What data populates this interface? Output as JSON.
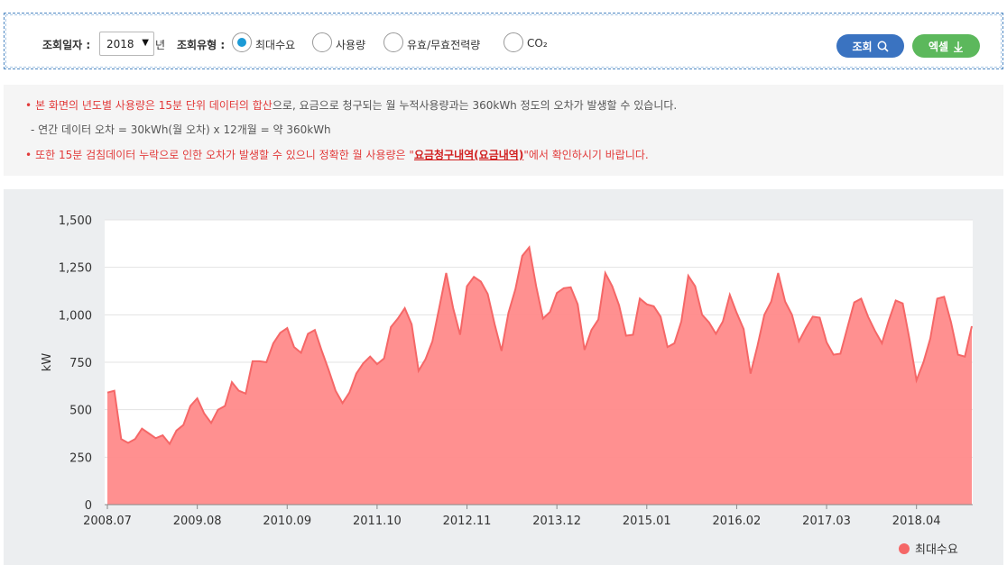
{
  "search": {
    "date_label": "조회일자 :",
    "year_value": "2018",
    "year_unit": "년",
    "type_label": "조회유형 :",
    "radio_options": [
      {
        "label": "최대수요",
        "checked": true
      },
      {
        "label": "사용량",
        "checked": false
      },
      {
        "label": "유효/무효전력량",
        "checked": false
      },
      {
        "label": "CO₂",
        "checked": false
      }
    ],
    "search_button": "조회",
    "excel_button": "엑셀",
    "search_icon": "search-icon",
    "excel_icon": "download-icon",
    "search_color": "#3a73c1",
    "excel_color": "#5cb85c"
  },
  "notice": {
    "line1_red": "본 화면의 년도별 사용량은 15분 단위 데이터의 합산",
    "line1_gray": "으로, 요금으로 청구되는 월 누적사용량과는 360kWh 정도의 오차가 발생할 수 있습니다.",
    "line2": "- 연간 데이터 오차 = 30kWh(월 오차) x 12개월 = 약 360kWh",
    "line3_before": "또한 15분 검침데이터 누락으로 인한 오차가 발생할 수 있으니 정확한 월 사용량은 \"",
    "line3_link": "요금청구내역(요금내역)",
    "line3_after": "\"에서 확인하시기 바랍니다."
  },
  "chart_data": {
    "type": "area",
    "ylabel": "kW",
    "ylim": [
      0,
      1500
    ],
    "yticks": [
      "0",
      "250",
      "500",
      "750",
      "1,000",
      "1,250",
      "1,500"
    ],
    "xticks": [
      "2008.07",
      "2009.08",
      "2010.09",
      "2011.10",
      "2012.11",
      "2013.12",
      "2015.01",
      "2016.02",
      "2017.03",
      "2018.04"
    ],
    "grid": true,
    "legend_position": "bottom-right",
    "series": [
      {
        "name": "최대수요",
        "color": "#f56767",
        "fill": "#ff8a8a",
        "values": [
          590,
          600,
          345,
          325,
          345,
          400,
          375,
          350,
          365,
          320,
          390,
          420,
          520,
          560,
          480,
          430,
          500,
          520,
          645,
          600,
          585,
          755,
          755,
          750,
          850,
          905,
          930,
          830,
          800,
          900,
          920,
          810,
          710,
          600,
          535,
          590,
          690,
          745,
          780,
          740,
          770,
          935,
          980,
          1035,
          950,
          705,
          765,
          860,
          1040,
          1220,
          1035,
          895,
          1150,
          1200,
          1175,
          1110,
          950,
          810,
          1010,
          1135,
          1310,
          1355,
          1150,
          980,
          1015,
          1115,
          1140,
          1145,
          1055,
          815,
          920,
          975,
          1220,
          1150,
          1050,
          890,
          895,
          1085,
          1055,
          1045,
          990,
          830,
          850,
          965,
          1205,
          1150,
          1000,
          960,
          900,
          965,
          1105,
          1010,
          925,
          690,
          835,
          1000,
          1070,
          1220,
          1070,
          1000,
          860,
          930,
          990,
          985,
          855,
          790,
          795,
          930,
          1065,
          1085,
          990,
          915,
          850,
          970,
          1075,
          1060,
          870,
          655,
          750,
          875,
          1085,
          1095,
          960,
          790,
          780,
          940
        ]
      }
    ]
  }
}
